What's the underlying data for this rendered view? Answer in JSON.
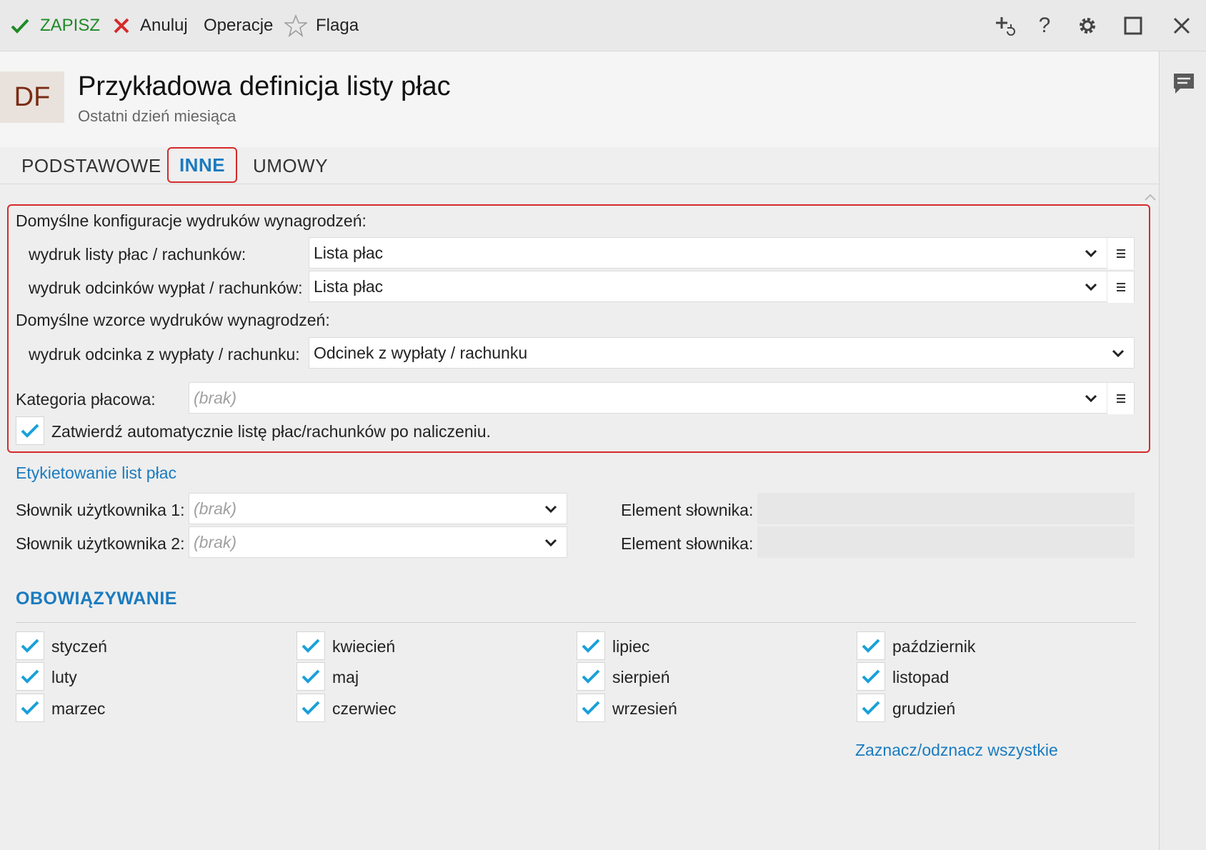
{
  "toolbar": {
    "save_label": "ZAPISZ",
    "cancel_label": "Anuluj",
    "operations_label": "Operacje",
    "flag_label": "Flaga",
    "save_color": "#1e8a27",
    "cancel_color": "#d62a2a"
  },
  "header": {
    "badge": "DF",
    "title": "Przykładowa definicja listy płac",
    "subtitle": "Ostatni dzień miesiąca"
  },
  "tabs": [
    {
      "label": "PODSTAWOWE",
      "active": false
    },
    {
      "label": "INNE",
      "active": true
    },
    {
      "label": "UMOWY",
      "active": false
    }
  ],
  "print_config": {
    "heading": "Domyślne konfiguracje wydruków wynagrodzeń:",
    "payroll_print_label": "wydruk listy płac / rachunków:",
    "payroll_print_value": "Lista płac",
    "payslips_print_label": "wydruk odcinków wypłat / rachunków:",
    "payslips_print_value": "Lista płac"
  },
  "print_templates": {
    "heading": "Domyślne wzorce wydruków wynagrodzeń:",
    "payslip_label": "wydruk odcinka z wypłaty / rachunku:",
    "payslip_value": "Odcinek z wypłaty / rachunku"
  },
  "pay_category": {
    "label": "Kategoria płacowa:",
    "placeholder": "(brak)"
  },
  "auto_approve": {
    "label": "Zatwierdź automatycznie listę płac/rachunków po naliczeniu.",
    "checked": true
  },
  "labeling": {
    "link": "Etykietowanie list płac",
    "dict1_label": "Słownik użytkownika 1:",
    "dict1_placeholder": "(brak)",
    "dict2_label": "Słownik użytkownika 2:",
    "dict2_placeholder": "(brak)",
    "element1_label": "Element słownika:",
    "element2_label": "Element słownika:"
  },
  "validity": {
    "title": "OBOWIĄZYWANIE",
    "months": [
      {
        "name": "styczeń",
        "checked": true
      },
      {
        "name": "luty",
        "checked": true
      },
      {
        "name": "marzec",
        "checked": true
      },
      {
        "name": "kwiecień",
        "checked": true
      },
      {
        "name": "maj",
        "checked": true
      },
      {
        "name": "czerwiec",
        "checked": true
      },
      {
        "name": "lipiec",
        "checked": true
      },
      {
        "name": "sierpień",
        "checked": true
      },
      {
        "name": "wrzesień",
        "checked": true
      },
      {
        "name": "październik",
        "checked": true
      },
      {
        "name": "listopad",
        "checked": true
      },
      {
        "name": "grudzień",
        "checked": true
      }
    ],
    "toggle_all_link": "Zaznacz/odznacz wszystkie"
  },
  "colors": {
    "accent": "#1a7bbf",
    "check": "#1aa0d8",
    "highlight_frame": "#d62a2a"
  }
}
